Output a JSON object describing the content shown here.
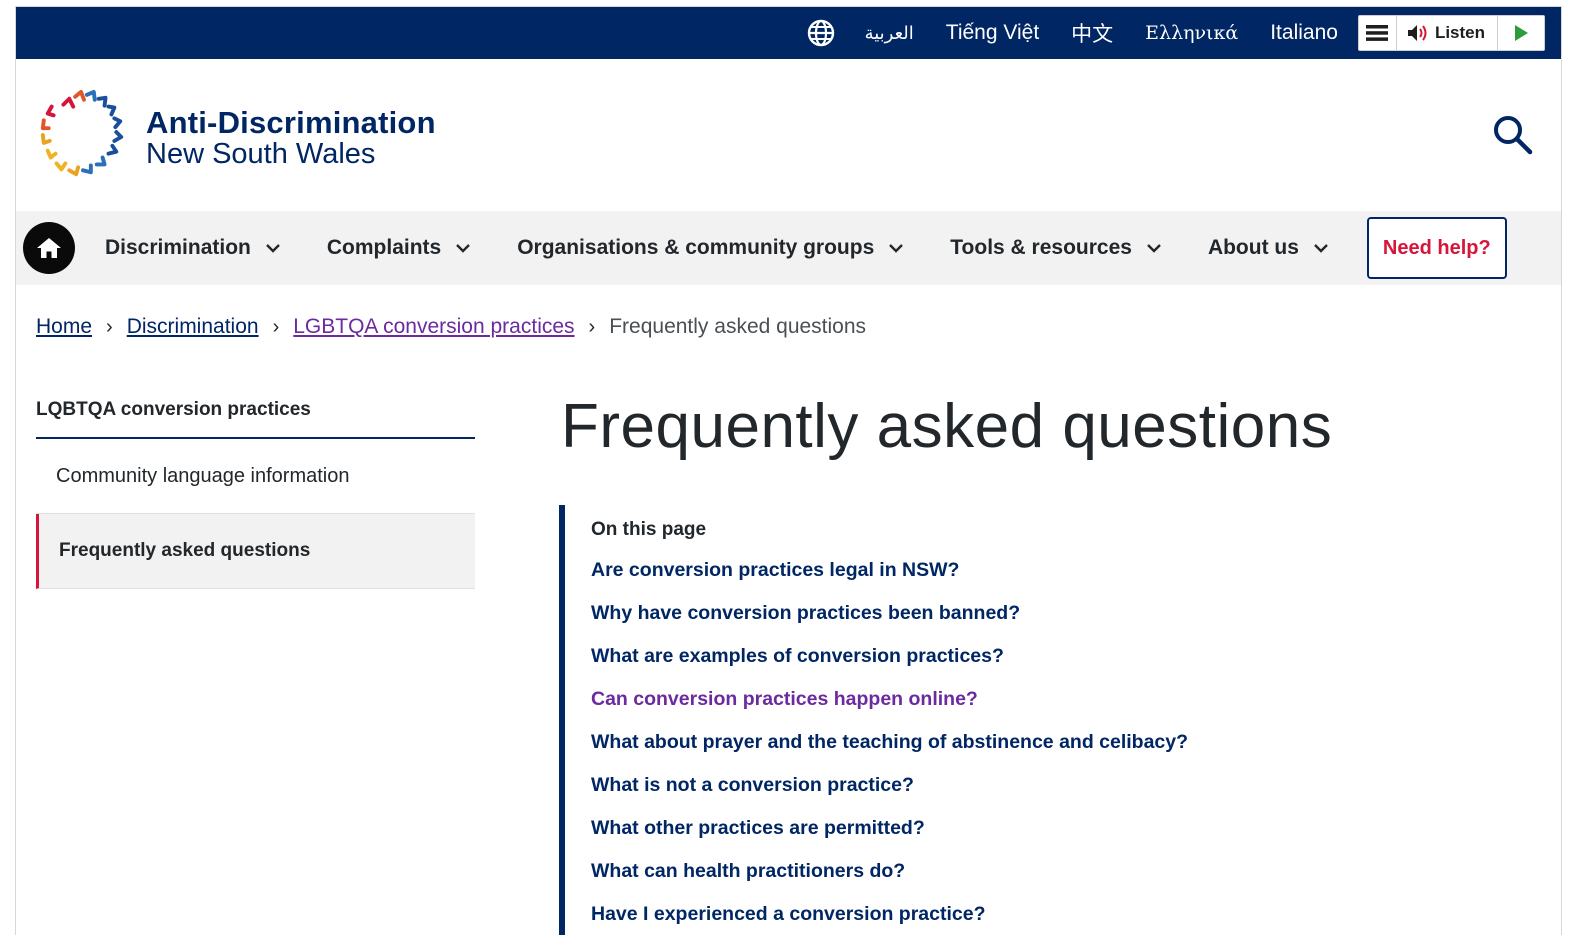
{
  "languages": [
    {
      "label": "العربية"
    },
    {
      "label": "Tiếng Việt"
    },
    {
      "label": "中文"
    },
    {
      "label": "Ελληνικά"
    },
    {
      "label": "Italiano"
    }
  ],
  "readspeaker": {
    "listen_label": "Listen"
  },
  "brand": {
    "line1": "Anti-Discrimination",
    "line2": "New South Wales"
  },
  "nav": {
    "items": [
      "Discrimination",
      "Complaints",
      "Organisations & community groups",
      "Tools & resources",
      "About us"
    ],
    "need_help": "Need help?"
  },
  "breadcrumb": {
    "home": "Home",
    "discrimination": "Discrimination",
    "section": "LGBTQA conversion practices",
    "current": "Frequently asked questions"
  },
  "sidenav": {
    "title": "LQBTQA conversion practices",
    "items": [
      "Community language information",
      "Frequently asked questions"
    ]
  },
  "page": {
    "title": "Frequently asked questions",
    "toc_title": "On this page",
    "toc": [
      "Are conversion practices legal in NSW?",
      "Why have conversion practices been banned?",
      "What are examples of conversion practices?",
      "Can conversion practices happen online?",
      "What about prayer and the teaching of abstinence and celibacy?",
      "What is not a conversion practice?",
      "What other practices are permitted?",
      "What can health practitioners do?",
      "Have I experienced a conversion practice?"
    ]
  },
  "colors": {
    "navy": "#002664",
    "accent_red": "#d7153a",
    "visited": "#6b2a9e",
    "nav_bg": "#f2f2f2"
  }
}
